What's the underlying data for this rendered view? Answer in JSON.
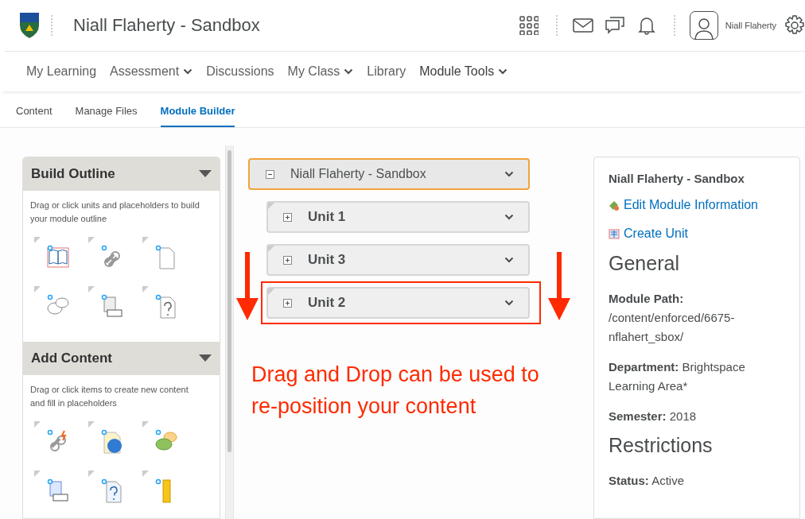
{
  "header": {
    "title": "Niall Flaherty - Sandbox",
    "user_name": "Niall Flaherty"
  },
  "nav": [
    {
      "label": "My Learning",
      "has_menu": false,
      "current": false
    },
    {
      "label": "Assessment",
      "has_menu": true,
      "current": false
    },
    {
      "label": "Discussions",
      "has_menu": false,
      "current": false
    },
    {
      "label": "My Class",
      "has_menu": true,
      "current": false
    },
    {
      "label": "Library",
      "has_menu": false,
      "current": false
    },
    {
      "label": "Module Tools",
      "has_menu": true,
      "current": true
    }
  ],
  "tabs": [
    {
      "label": "Content",
      "selected": false
    },
    {
      "label": "Manage Files",
      "selected": false
    },
    {
      "label": "Module Builder",
      "selected": true
    }
  ],
  "palettes": [
    {
      "title": "Build Outline",
      "expanded": true,
      "hint": "Drag or click units and placeholders to build your module outline"
    },
    {
      "title": "Add Content",
      "expanded": true,
      "hint": "Drag or click items to create new content and fill in placeholders"
    }
  ],
  "tree": {
    "label": "Niall Flaherty - Sandbox",
    "expanded": true,
    "selected": true,
    "children": [
      {
        "label": "Unit 1",
        "expanded": false,
        "highlighted": false
      },
      {
        "label": "Unit 3",
        "expanded": false,
        "highlighted": false
      },
      {
        "label": "Unit 2",
        "expanded": false,
        "highlighted": true
      }
    ]
  },
  "annotation": {
    "caption": "Drag and Drop can be used to re-position your content"
  },
  "info": {
    "title": "Niall Flaherty - Sandbox",
    "links": [
      "Edit Module Information",
      "Create Unit"
    ],
    "sections": [
      {
        "heading": "General",
        "details": [
          "**Module Path:** /content/enforced/6675-nflahert_sbox/",
          "**Department:** Brightspace Learning Area*",
          "**Semester:** 2018"
        ]
      },
      {
        "heading": "Restrictions",
        "details": [
          "**Status:** Active"
        ]
      }
    ]
  }
}
